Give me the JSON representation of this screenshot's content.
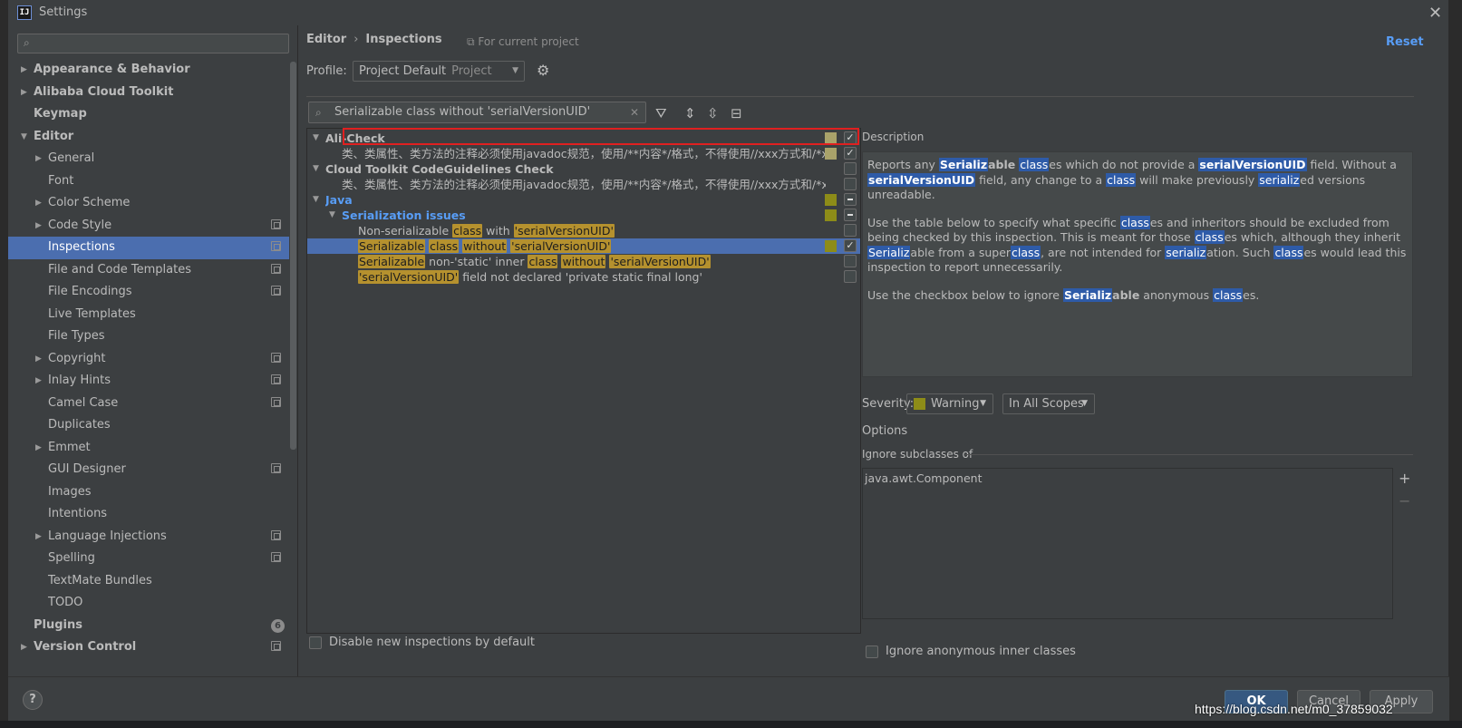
{
  "window": {
    "title": "Settings",
    "app_icon": "intellij-icon",
    "close_icon": "close-icon"
  },
  "sidebar": {
    "search_placeholder": "",
    "items": [
      {
        "label": "Appearance & Behavior",
        "level": 0,
        "bold": true,
        "arrow": "right",
        "proj": false
      },
      {
        "label": "Alibaba Cloud Toolkit",
        "level": 0,
        "bold": true,
        "arrow": "right",
        "proj": false
      },
      {
        "label": "Keymap",
        "level": 0,
        "bold": true,
        "arrow": "",
        "proj": false
      },
      {
        "label": "Editor",
        "level": 0,
        "bold": true,
        "arrow": "down",
        "proj": false
      },
      {
        "label": "General",
        "level": 1,
        "bold": false,
        "arrow": "right",
        "proj": false
      },
      {
        "label": "Font",
        "level": 1,
        "bold": false,
        "arrow": "",
        "proj": false
      },
      {
        "label": "Color Scheme",
        "level": 1,
        "bold": false,
        "arrow": "right",
        "proj": false
      },
      {
        "label": "Code Style",
        "level": 1,
        "bold": false,
        "arrow": "right",
        "proj": true
      },
      {
        "label": "Inspections",
        "level": 1,
        "bold": false,
        "arrow": "",
        "proj": true,
        "selected": true
      },
      {
        "label": "File and Code Templates",
        "level": 1,
        "bold": false,
        "arrow": "",
        "proj": true
      },
      {
        "label": "File Encodings",
        "level": 1,
        "bold": false,
        "arrow": "",
        "proj": true
      },
      {
        "label": "Live Templates",
        "level": 1,
        "bold": false,
        "arrow": "",
        "proj": false
      },
      {
        "label": "File Types",
        "level": 1,
        "bold": false,
        "arrow": "",
        "proj": false
      },
      {
        "label": "Copyright",
        "level": 1,
        "bold": false,
        "arrow": "right",
        "proj": true
      },
      {
        "label": "Inlay Hints",
        "level": 1,
        "bold": false,
        "arrow": "right",
        "proj": true
      },
      {
        "label": "Camel Case",
        "level": 1,
        "bold": false,
        "arrow": "",
        "proj": true
      },
      {
        "label": "Duplicates",
        "level": 1,
        "bold": false,
        "arrow": "",
        "proj": false
      },
      {
        "label": "Emmet",
        "level": 1,
        "bold": false,
        "arrow": "right",
        "proj": false
      },
      {
        "label": "GUI Designer",
        "level": 1,
        "bold": false,
        "arrow": "",
        "proj": true
      },
      {
        "label": "Images",
        "level": 1,
        "bold": false,
        "arrow": "",
        "proj": false
      },
      {
        "label": "Intentions",
        "level": 1,
        "bold": false,
        "arrow": "",
        "proj": false
      },
      {
        "label": "Language Injections",
        "level": 1,
        "bold": false,
        "arrow": "right",
        "proj": true
      },
      {
        "label": "Spelling",
        "level": 1,
        "bold": false,
        "arrow": "",
        "proj": true
      },
      {
        "label": "TextMate Bundles",
        "level": 1,
        "bold": false,
        "arrow": "",
        "proj": false
      },
      {
        "label": "TODO",
        "level": 1,
        "bold": false,
        "arrow": "",
        "proj": false
      },
      {
        "label": "Plugins",
        "level": 0,
        "bold": true,
        "arrow": "",
        "proj": false,
        "badge": "6"
      },
      {
        "label": "Version Control",
        "level": 0,
        "bold": true,
        "arrow": "right",
        "proj": true
      }
    ]
  },
  "header": {
    "crumb_1": "Editor",
    "crumb_sep": "›",
    "crumb_2": "Inspections",
    "for_project": "For current project",
    "reset": "Reset",
    "profile_label": "Profile:",
    "profile_value": "Project Default",
    "profile_scope": "Project"
  },
  "inspection_search": {
    "value": "Serializable class without 'serialVersionUID'"
  },
  "tree_rows": [
    {
      "type": "group",
      "label": "Ali-Check",
      "color": "normal",
      "indent": 0,
      "sev": "tan",
      "check": "checked"
    },
    {
      "type": "text",
      "label": "类、类属性、类方法的注释必须使用javadoc规范，使用/**内容*/格式，不得使用//xxx方式和/*xxx*/方:",
      "indent": 2,
      "sev": "tan",
      "check": "checked"
    },
    {
      "type": "group",
      "label": "Cloud Toolkit CodeGuidelines Check",
      "color": "normal",
      "indent": 0,
      "sev": "",
      "check": "unchecked"
    },
    {
      "type": "text",
      "label": "类、类属性、类方法的注释必须使用javadoc规范，使用/**内容*/格式，不得使用//xxx方式和/*xxx*/方:",
      "indent": 2,
      "sev": "",
      "check": "unchecked"
    },
    {
      "type": "group",
      "label": "Java",
      "color": "blue",
      "indent": 0,
      "sev": "olive",
      "check": "dash"
    },
    {
      "type": "group",
      "label": "Serialization issues",
      "color": "blue",
      "indent": 1,
      "sev": "olive",
      "check": "dash"
    },
    {
      "type": "parts",
      "indent": 3,
      "sev": "",
      "check": "unchecked",
      "parts": [
        {
          "t": "Non-serializable ",
          "h": false
        },
        {
          "t": "class",
          "h": true
        },
        {
          "t": " with ",
          "h": false
        },
        {
          "t": "'serialVersionUID'",
          "h": true
        }
      ]
    },
    {
      "type": "parts",
      "indent": 3,
      "sev": "olive",
      "check": "checked",
      "selected": true,
      "parts": [
        {
          "t": "Serializable",
          "h": true
        },
        {
          "t": " ",
          "h": false
        },
        {
          "t": "class",
          "h": true
        },
        {
          "t": " ",
          "h": false
        },
        {
          "t": "without",
          "h": true
        },
        {
          "t": " ",
          "h": false
        },
        {
          "t": "'serialVersionUID'",
          "h": true
        }
      ]
    },
    {
      "type": "parts",
      "indent": 3,
      "sev": "",
      "check": "unchecked",
      "parts": [
        {
          "t": "Serializable",
          "h": true
        },
        {
          "t": " non-'static' inner ",
          "h": false
        },
        {
          "t": "class",
          "h": true
        },
        {
          "t": " ",
          "h": false
        },
        {
          "t": "without",
          "h": true
        },
        {
          "t": " ",
          "h": false
        },
        {
          "t": "'serialVersionUID'",
          "h": true
        }
      ]
    },
    {
      "type": "parts",
      "indent": 3,
      "sev": "",
      "check": "unchecked",
      "parts": [
        {
          "t": "'serialVersionUID'",
          "h": true
        },
        {
          "t": " field not declared 'private static final long'",
          "h": false
        }
      ]
    }
  ],
  "disable_new": {
    "label": "Disable new inspections by default"
  },
  "description": {
    "label": "Description",
    "paragraphs": [
      [
        {
          "t": "Reports any "
        },
        {
          "t": "Serializ",
          "s": "b"
        },
        {
          "t": "able",
          "s": "bold"
        },
        {
          "t": " "
        },
        {
          "t": "class",
          "s": "n"
        },
        {
          "t": "es which do not provide a "
        },
        {
          "t": "serialVersionUID",
          "s": "b"
        },
        {
          "t": " field. Without a "
        },
        {
          "t": "serialVersionUID",
          "s": "b"
        },
        {
          "t": " field, any change to a "
        },
        {
          "t": "class",
          "s": "n"
        },
        {
          "t": " will make previously "
        },
        {
          "t": "serializ",
          "s": "n"
        },
        {
          "t": "ed versions unreadable."
        }
      ],
      [
        {
          "t": "Use the table below to specify what specific "
        },
        {
          "t": "class",
          "s": "n"
        },
        {
          "t": "es and inheritors should be excluded from being checked by this inspection. This is meant for those "
        },
        {
          "t": "class",
          "s": "n"
        },
        {
          "t": "es which, although they inherit "
        },
        {
          "t": "Serializ",
          "s": "n"
        },
        {
          "t": "able from a super"
        },
        {
          "t": "class",
          "s": "n"
        },
        {
          "t": ", are not intended for "
        },
        {
          "t": "serializ",
          "s": "n"
        },
        {
          "t": "ation. Such "
        },
        {
          "t": "class",
          "s": "n"
        },
        {
          "t": "es would lead this inspection to report unnecessarily."
        }
      ],
      [
        {
          "t": "Use the checkbox below to ignore "
        },
        {
          "t": "Serializ",
          "s": "b"
        },
        {
          "t": "able",
          "s": "bold"
        },
        {
          "t": " anonymous "
        },
        {
          "t": "class",
          "s": "n"
        },
        {
          "t": "es."
        }
      ]
    ]
  },
  "severity": {
    "label": "Severity:",
    "value": "Warning",
    "swatch_color": "#8d8c18",
    "scope": "In All Scopes"
  },
  "options": {
    "label": "Options",
    "ignore_sub_label": "Ignore subclasses of",
    "list": [
      "java.awt.Component"
    ],
    "add": "+",
    "remove": "−",
    "anon_label": "Ignore anonymous inner classes"
  },
  "footer": {
    "help": "?",
    "ok": "OK",
    "cancel": "Cancel",
    "apply": "Apply"
  },
  "watermark": "https://blog.csdn.net/m0_37859032"
}
